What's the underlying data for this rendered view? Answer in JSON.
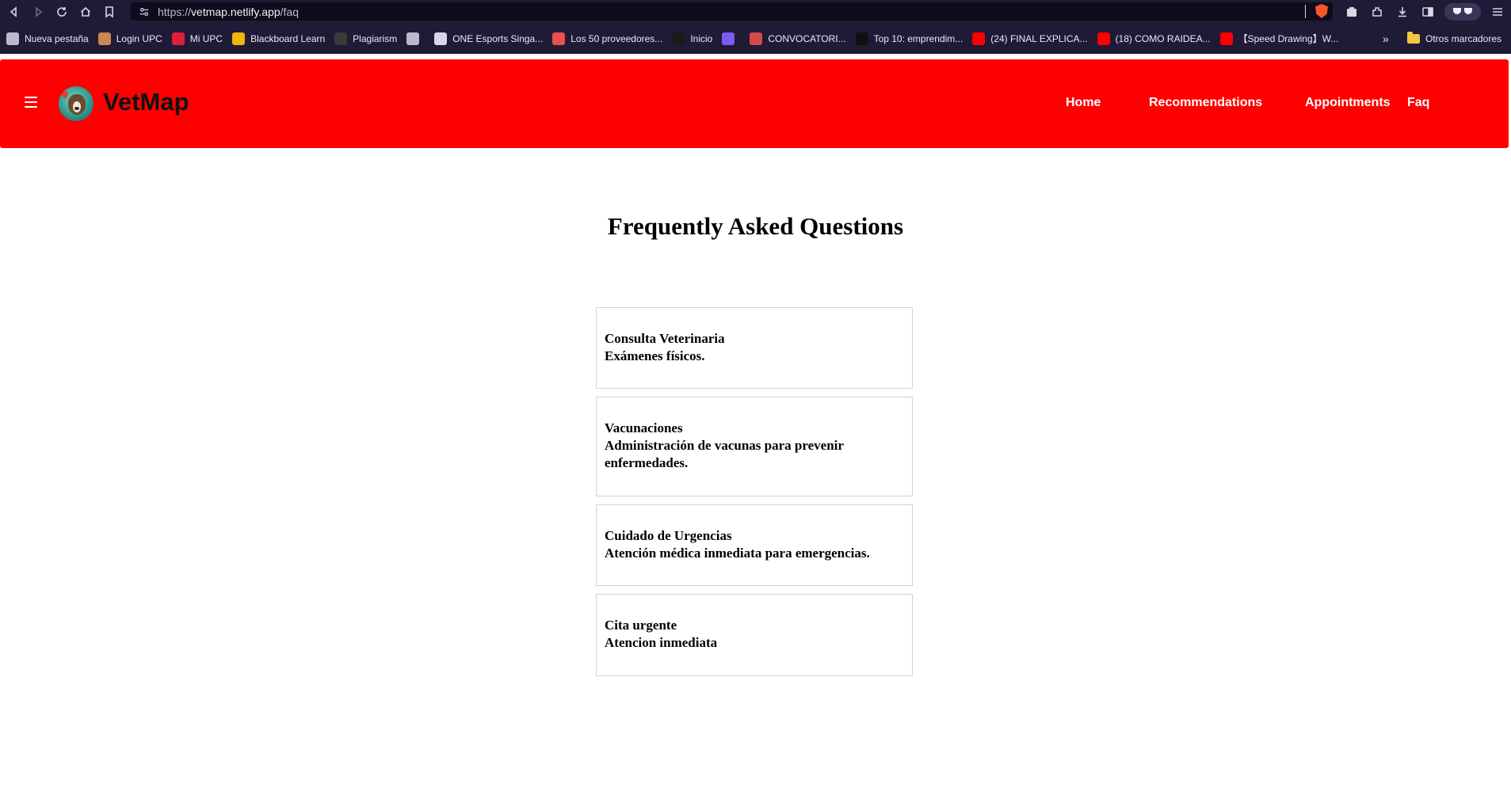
{
  "browser": {
    "url_prefix": "https://",
    "url_host": "vetmap.netlify.app",
    "url_path": "/faq",
    "bookmarks": [
      {
        "label": "Nueva pestaña",
        "color": "#bdb9cc"
      },
      {
        "label": "Login UPC",
        "color": "#c9894f"
      },
      {
        "label": "Mi UPC",
        "color": "#e0203a"
      },
      {
        "label": "Blackboard Learn",
        "color": "#f2b705"
      },
      {
        "label": "Plagiarism",
        "color": "#3a3a3a"
      },
      {
        "label": "",
        "color": "#bdb9cc"
      },
      {
        "label": "ONE Esports Singa...",
        "color": "#d9d6e6"
      },
      {
        "label": "Los 50 proveedores...",
        "color": "#e8524a"
      },
      {
        "label": "Inicio",
        "color": "#1a1a1a"
      },
      {
        "label": "",
        "color": "#7b5cf0"
      },
      {
        "label": "CONVOCATORI...",
        "color": "#d44a4a"
      },
      {
        "label": "Top 10: emprendim...",
        "color": "#111111"
      },
      {
        "label": "(24) FINAL EXPLICA...",
        "color": "#ff0000"
      },
      {
        "label": "(18) COMO RAIDEA...",
        "color": "#ff0000"
      },
      {
        "label": "【Speed Drawing】W...",
        "color": "#ff0000"
      }
    ],
    "more_label": "»",
    "other_bookmarks": "Otros marcadores"
  },
  "site": {
    "brand": "VetMap",
    "nav": [
      "Home",
      "Recommendations",
      "Appointments",
      "Faq"
    ],
    "header_color": "#ff0000"
  },
  "faq": {
    "title": "Frequently Asked Questions",
    "items": [
      {
        "question": "Consulta Veterinaria",
        "answer": "Exámenes físicos."
      },
      {
        "question": "Vacunaciones",
        "answer": "Administración de vacunas para prevenir enfermedades."
      },
      {
        "question": "Cuidado de Urgencias",
        "answer": "Atención médica inmediata para emergencias."
      },
      {
        "question": "Cita urgente",
        "answer": "Atencion inmediata"
      }
    ]
  }
}
